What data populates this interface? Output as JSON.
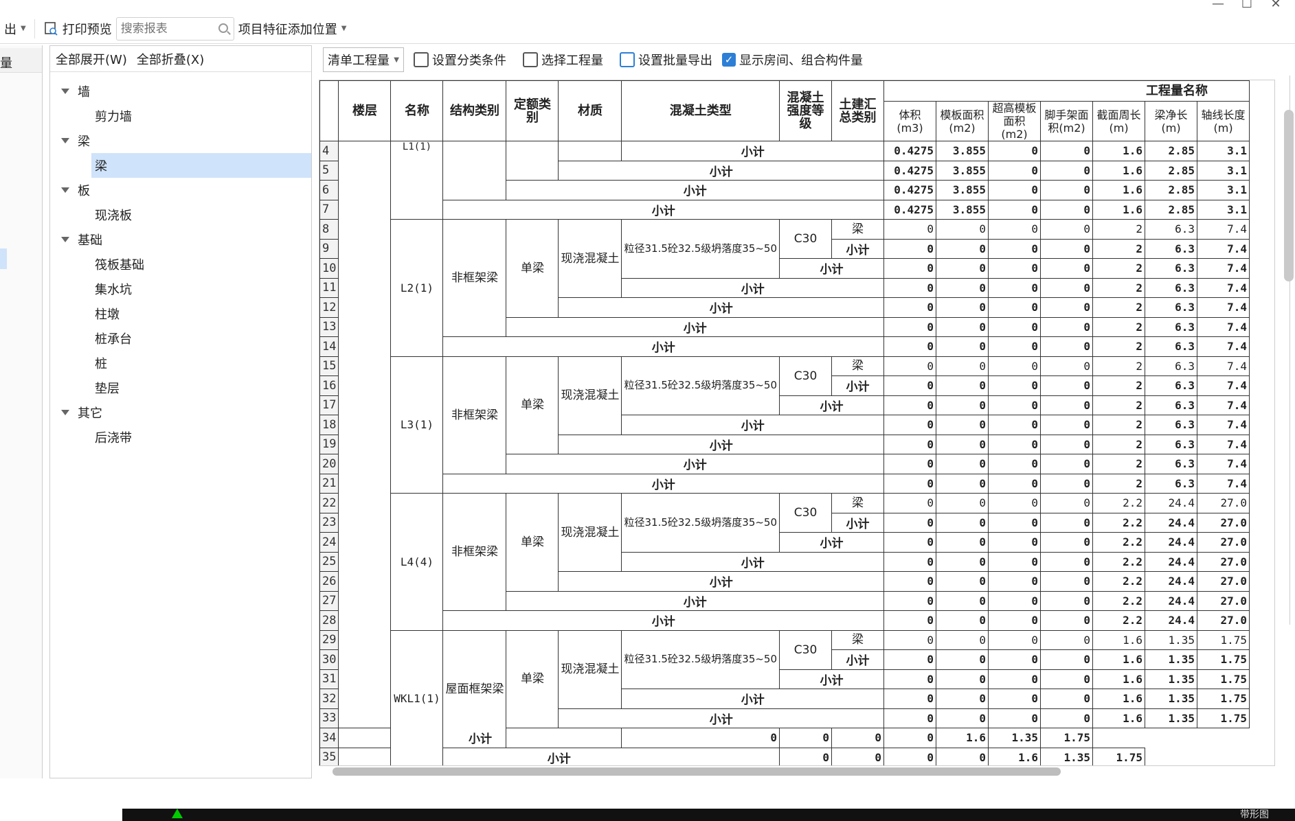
{
  "window": {
    "min": "—",
    "max": "☐",
    "close": "✕"
  },
  "toolbar": {
    "export_label": "出",
    "print_preview_label": "打印预览",
    "search_placeholder": "搜索报表",
    "feature_position_label": "项目特征添加位置"
  },
  "left_edge": {
    "tab_label": "量"
  },
  "tree_pane": {
    "expand_all": "全部展开(W)",
    "collapse_all": "全部折叠(X)",
    "nodes": [
      {
        "label": "墙",
        "level": 0
      },
      {
        "label": "剪力墙",
        "level": 1
      },
      {
        "label": "梁",
        "level": 0
      },
      {
        "label": "梁",
        "level": 1,
        "selected": true
      },
      {
        "label": "板",
        "level": 0
      },
      {
        "label": "现浇板",
        "level": 1
      },
      {
        "label": "基础",
        "level": 0
      },
      {
        "label": "筏板基础",
        "level": 1
      },
      {
        "label": "集水坑",
        "level": 1
      },
      {
        "label": "柱墩",
        "level": 1
      },
      {
        "label": "桩承台",
        "level": 1
      },
      {
        "label": "桩",
        "level": 1
      },
      {
        "label": "垫层",
        "level": 1
      },
      {
        "label": "其它",
        "level": 0
      },
      {
        "label": "后浇带",
        "level": 1
      }
    ]
  },
  "grid_toolbar": {
    "mode": "清单工程量",
    "set_category": "设置分类条件",
    "select_quantities": "选择工程量",
    "batch_export": "设置批量导出",
    "show_rooms_label": "显示房间、组合构件量",
    "show_rooms_checked": true
  },
  "grid": {
    "headers": {
      "floor": "楼层",
      "name": "名称",
      "struct": "结构类别",
      "quota": "定额类别",
      "material": "材质",
      "concrete_type": "混凝土类型",
      "strength": "混凝土强度等级",
      "civil_cat": "土建汇总类别",
      "qty_group": "工程量名称",
      "qty_cols": [
        "体积(m3)",
        "模板面积(m2)",
        "超高模板面积(m2)",
        "脚手架面积(m2)",
        "截面周长(m)",
        "梁净长(m)",
        "轴线长度(m)"
      ]
    },
    "subtotal": "小计",
    "beam_label": "梁",
    "material_text": "现浇混凝土",
    "concrete_text": "粒径31.5砼32.5级坍落度35~50",
    "strength_text": "C30",
    "single_beam": "单梁",
    "l1": {
      "name": "L1(1)",
      "rows": [
        {
          "n": "4",
          "v": [
            "0.4275",
            "3.855",
            "0",
            "0",
            "1.6",
            "2.85",
            "3.1"
          ]
        },
        {
          "n": "5",
          "v": [
            "0.4275",
            "3.855",
            "0",
            "0",
            "1.6",
            "2.85",
            "3.1"
          ]
        },
        {
          "n": "6",
          "v": [
            "0.4275",
            "3.855",
            "0",
            "0",
            "1.6",
            "2.85",
            "3.1"
          ]
        },
        {
          "n": "7",
          "v": [
            "0.4275",
            "3.855",
            "0",
            "0",
            "1.6",
            "2.85",
            "3.1"
          ]
        }
      ]
    },
    "groups": [
      {
        "name": "L2(1)",
        "struct": "非框架梁",
        "start": 8,
        "v": [
          "0",
          "0",
          "0",
          "0",
          "2",
          "6.3",
          "7.4"
        ]
      },
      {
        "name": "L3(1)",
        "struct": "非框架梁",
        "start": 15,
        "v": [
          "0",
          "0",
          "0",
          "0",
          "2",
          "6.3",
          "7.4"
        ]
      },
      {
        "name": "L4(4)",
        "struct": "非框架梁",
        "start": 22,
        "v": [
          "0",
          "0",
          "0",
          "0",
          "2.2",
          "24.4",
          "27.0"
        ]
      },
      {
        "name": "WKL1(1)",
        "struct": "屋面框架梁",
        "start": 29,
        "v": [
          "0",
          "0",
          "0",
          "0",
          "1.6",
          "1.35",
          "1.75"
        ]
      }
    ]
  },
  "bottombar": {
    "label": "带形图"
  }
}
